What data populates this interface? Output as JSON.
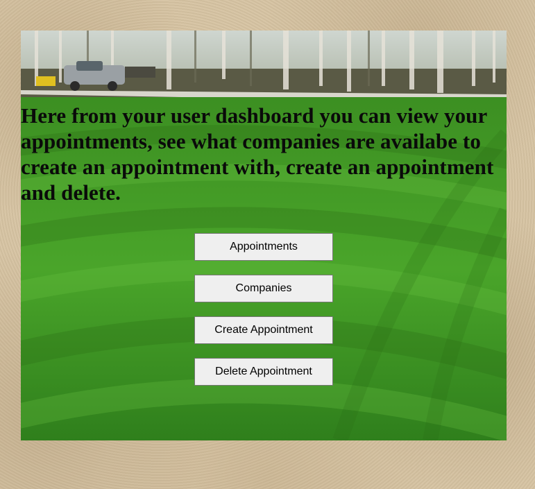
{
  "hero": {
    "image_icon": "lawn-photo-icon",
    "intro_text": "Here from your user dashboard you can view your appointments, see what companies are availabe to create an appointment with, create an appointment and delete."
  },
  "actions": {
    "appointments_label": "Appointments",
    "companies_label": "Companies",
    "create_appointment_label": "Create Appointment",
    "delete_appointment_label": "Delete Appointment"
  },
  "colors": {
    "page_background": "#d6c3a2",
    "grass": "#3f9a22",
    "button_background": "#efefef",
    "button_border": "#767676",
    "heading_text": "#0a0a0a"
  }
}
